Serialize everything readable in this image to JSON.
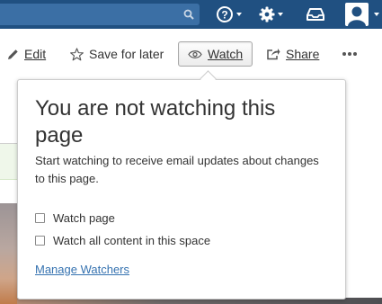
{
  "topbar": {
    "search_icon": "search-icon",
    "help_icon": "question-circle-icon",
    "settings_icon": "gear-icon",
    "notifications_icon": "inbox-icon",
    "avatar_icon": "user-avatar-icon"
  },
  "toolbar": {
    "edit_label": "Edit",
    "save_label": "Save for later",
    "watch_label": "Watch",
    "share_label": "Share",
    "more_icon": "more-dots-icon"
  },
  "watch_popup": {
    "title": "You are not watching this page",
    "description": "Start watching to receive email updates about changes to this page.",
    "options": [
      {
        "label": "Watch page",
        "checked": false
      },
      {
        "label": "Watch all content in this space",
        "checked": false
      }
    ],
    "manage_link": "Manage Watchers"
  },
  "colors": {
    "header_bg": "#205081",
    "link": "#3572b0",
    "text": "#333333"
  }
}
